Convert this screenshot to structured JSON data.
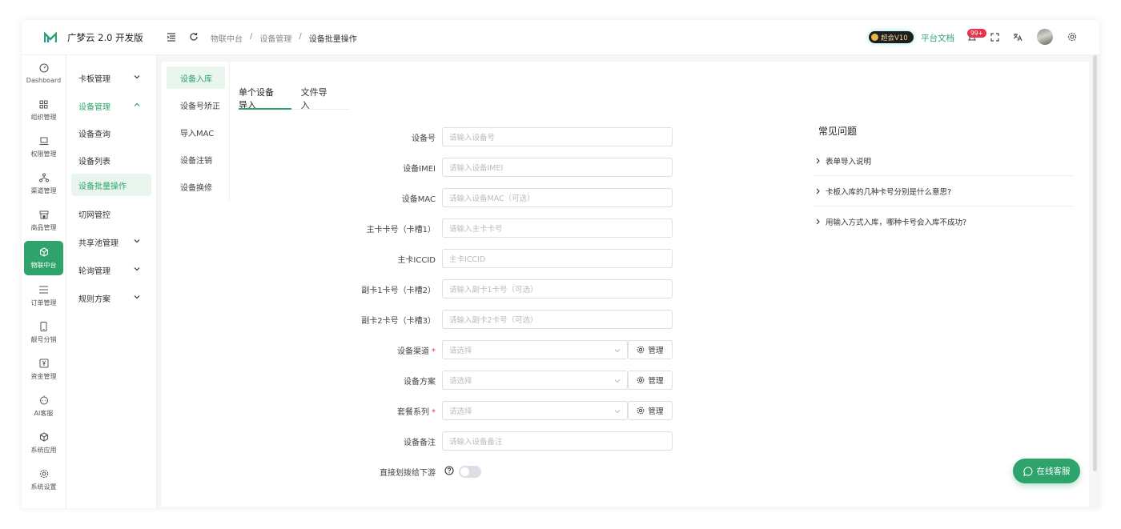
{
  "app": {
    "name": "广梦云 2.0 开发版"
  },
  "breadcrumb": [
    "物联中台",
    "/",
    "设备管理",
    "/",
    "设备批量操作"
  ],
  "topbar": {
    "vip_label": "超会V10",
    "doc_link": "平台文档",
    "notif_count": "99+"
  },
  "iconbar": [
    {
      "label": "Dashboard",
      "icon": "dashboard-icon"
    },
    {
      "label": "组织管理",
      "icon": "grid-icon"
    },
    {
      "label": "权限管理",
      "icon": "laptop-icon"
    },
    {
      "label": "渠道管理",
      "icon": "network-icon"
    },
    {
      "label": "商品管理",
      "icon": "store-icon"
    },
    {
      "label": "物联中台",
      "icon": "cube-icon"
    },
    {
      "label": "订单管理",
      "icon": "list-icon"
    },
    {
      "label": "靓号分销",
      "icon": "phone-icon"
    },
    {
      "label": "资金管理",
      "icon": "money-icon"
    },
    {
      "label": "AI客服",
      "icon": "bot-icon"
    },
    {
      "label": "系统应用",
      "icon": "box-icon"
    },
    {
      "label": "系统设置",
      "icon": "gear-icon"
    }
  ],
  "menu": {
    "items": [
      "卡板管理",
      "设备管理",
      "设备查询",
      "设备列表",
      "设备批量操作",
      "切网管控",
      "共享池管理",
      "轮询管理",
      "规则方案"
    ]
  },
  "subnav": [
    "设备入库",
    "设备号矫正",
    "导入MAC",
    "设备注销",
    "设备换修"
  ],
  "tabs": [
    "单个设备导入",
    "文件导入"
  ],
  "form": {
    "fields": [
      {
        "label": "设备号",
        "placeholder": "请输入设备号"
      },
      {
        "label": "设备IMEI",
        "placeholder": "请输入设备IMEI"
      },
      {
        "label": "设备MAC",
        "placeholder": "请输入设备MAC（可选）"
      },
      {
        "label": "主卡卡号（卡槽1）",
        "placeholder": "请输入主卡卡号"
      },
      {
        "label": "主卡ICCID",
        "placeholder": "主卡ICCID"
      },
      {
        "label": "副卡1卡号（卡槽2）",
        "placeholder": "请输入副卡1卡号（可选）"
      },
      {
        "label": "副卡2卡号（卡槽3）",
        "placeholder": "请输入副卡2卡号（可选）"
      }
    ],
    "selects": [
      {
        "label": "设备渠道",
        "required": "*",
        "placeholder": "请选择",
        "manage": "管理"
      },
      {
        "label": "设备方案",
        "required": "",
        "placeholder": "请选择",
        "manage": "管理"
      },
      {
        "label": "套餐系列",
        "required": "*",
        "placeholder": "请选择",
        "manage": "管理"
      }
    ],
    "remark": {
      "label": "设备备注",
      "placeholder": "请输入设备备注"
    },
    "transfer": {
      "label": "直接划拨给下游"
    }
  },
  "faq": {
    "title": "常见问题",
    "items": [
      "表单导入说明",
      "卡板入库的几种卡号分别是什么意思?",
      "用输入方式入库，哪种卡号会入库不成功?"
    ]
  },
  "service": {
    "label": "在线客服"
  },
  "colors": {
    "accent": "#2ea36b",
    "badge": "#e8334a"
  }
}
